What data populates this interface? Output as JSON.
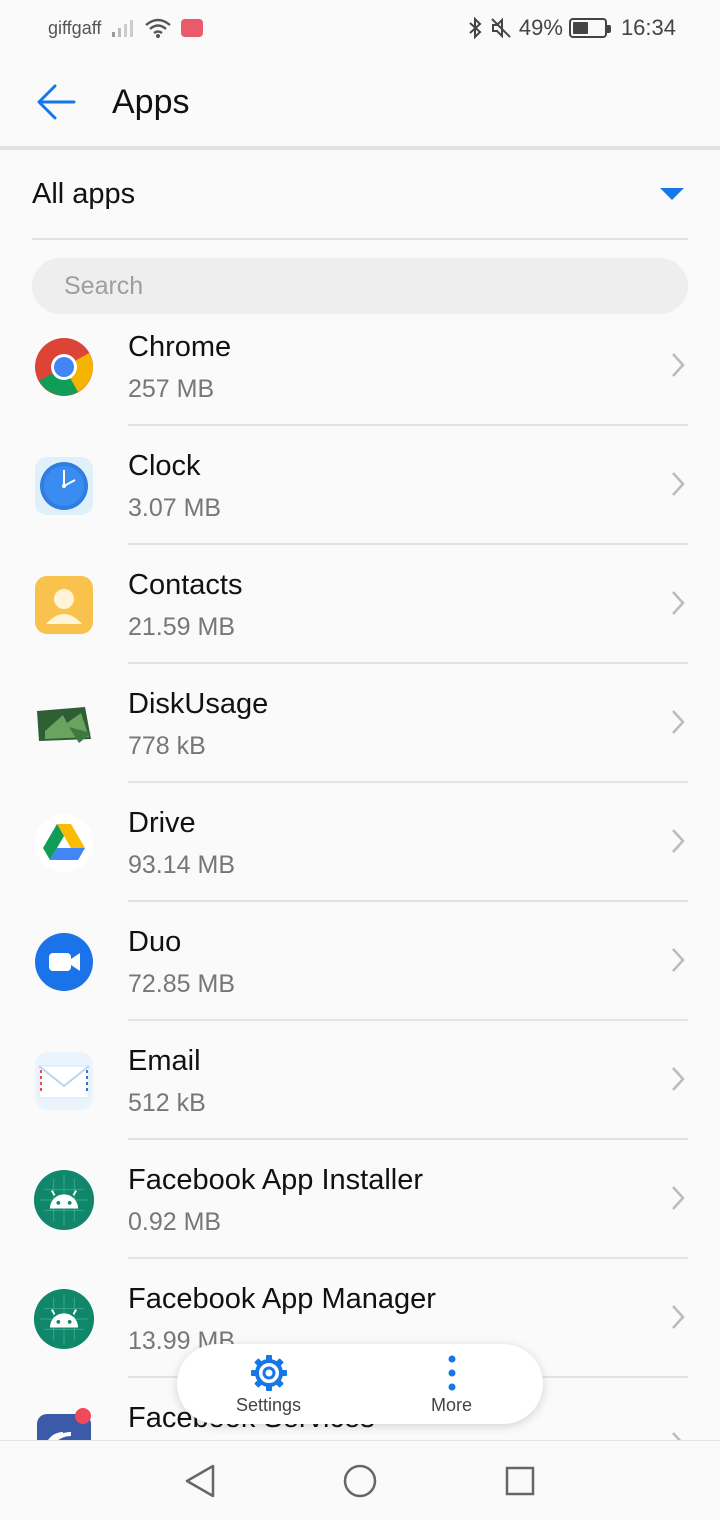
{
  "status_bar": {
    "carrier": "giffgaff",
    "battery_percent": "49%",
    "time": "16:34",
    "battery_level": 0.49
  },
  "header": {
    "title": "Apps",
    "back_icon": "arrow-left-icon"
  },
  "filter": {
    "selected": "All apps",
    "accent_color": "#1677e6"
  },
  "search": {
    "placeholder": "Search",
    "value": ""
  },
  "apps": [
    {
      "name": "Chrome",
      "size": "257 MB",
      "icon": "chrome-icon"
    },
    {
      "name": "Clock",
      "size": "3.07 MB",
      "icon": "clock-icon"
    },
    {
      "name": "Contacts",
      "size": "21.59 MB",
      "icon": "contacts-icon"
    },
    {
      "name": "DiskUsage",
      "size": "778 kB",
      "icon": "diskusage-icon"
    },
    {
      "name": "Drive",
      "size": "93.14 MB",
      "icon": "drive-icon"
    },
    {
      "name": "Duo",
      "size": "72.85 MB",
      "icon": "duo-icon"
    },
    {
      "name": "Email",
      "size": "512 kB",
      "icon": "email-icon"
    },
    {
      "name": "Facebook App Installer",
      "size": "0.92 MB",
      "icon": "android-icon"
    },
    {
      "name": "Facebook App Manager",
      "size": "13.99 MB",
      "icon": "android-icon"
    },
    {
      "name": "Facebook Services",
      "size": "",
      "icon": "facebook-services-icon"
    }
  ],
  "toolbar": {
    "settings_label": "Settings",
    "more_label": "More"
  },
  "nav": {
    "back": "triangle-back-icon",
    "home": "circle-home-icon",
    "recents": "square-recents-icon"
  }
}
